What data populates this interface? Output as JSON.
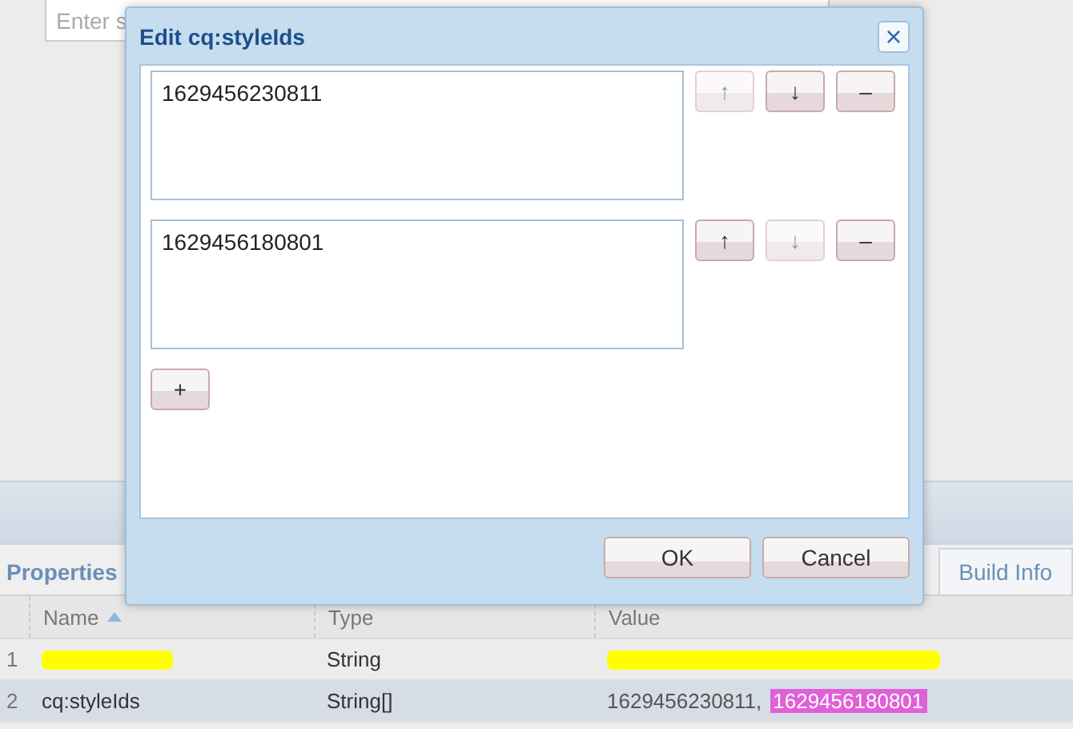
{
  "search": {
    "placeholder": "Enter s"
  },
  "dialog": {
    "title": "Edit cq:styleIds",
    "close": "×",
    "entries": [
      {
        "value": "1629456230811",
        "buttons": [
          {
            "label": "↑",
            "disabled": true
          },
          {
            "label": "↓",
            "disabled": false
          },
          {
            "label": "–",
            "disabled": false
          }
        ]
      },
      {
        "value": "1629456180801",
        "buttons": [
          {
            "label": "↑",
            "disabled": false
          },
          {
            "label": "↓",
            "disabled": true
          },
          {
            "label": "–",
            "disabled": false
          }
        ]
      }
    ],
    "add_button": "+",
    "buttons": [
      "OK",
      "Cancel"
    ]
  },
  "panel": {
    "tabs": [
      {
        "label": "Properties",
        "selected": true
      },
      {
        "label": "Build Info",
        "selected": false
      }
    ],
    "columns": [
      {
        "label": "Name",
        "sorted": true
      },
      {
        "label": "Type",
        "sorted": false
      },
      {
        "label": "Value",
        "sorted": false
      }
    ],
    "rows": [
      {
        "number": "1",
        "selected": false,
        "name": {
          "redacted": true
        },
        "type": "String",
        "value": [
          {
            "redacted": true
          }
        ]
      },
      {
        "number": "2",
        "selected": true,
        "name": {
          "text": "cq:styleIds"
        },
        "type": "String[]",
        "value": [
          {
            "text": "1629456230811, ",
            "highlighted": false
          },
          {
            "text": "1629456180801",
            "highlighted": true
          }
        ]
      }
    ]
  }
}
